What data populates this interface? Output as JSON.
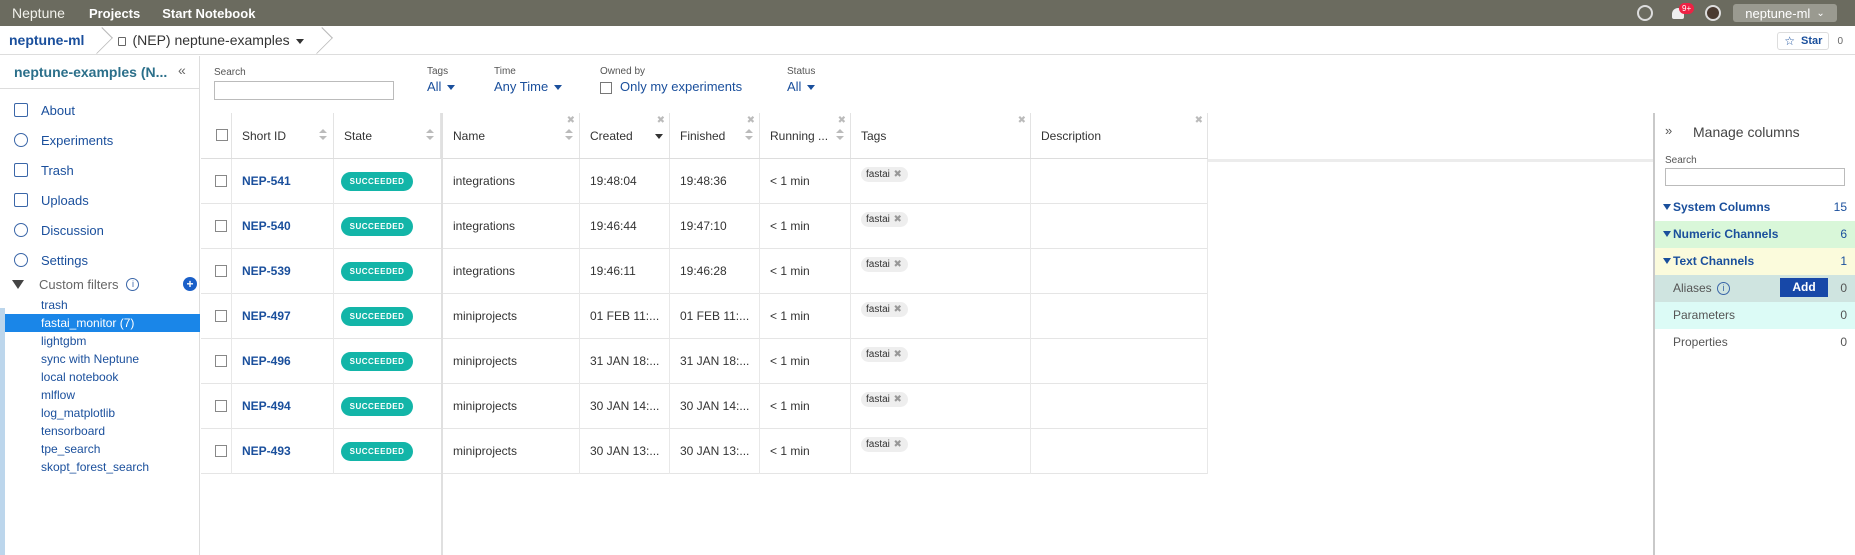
{
  "topbar": {
    "logo": "Neptune",
    "nav": [
      "Projects",
      "Start Notebook"
    ],
    "notification_badge": "9+",
    "user": "neptune-ml"
  },
  "breadcrumb": {
    "org": "neptune-ml",
    "project": "(NEP) neptune-examples",
    "star_label": "Star",
    "star_count": "0"
  },
  "sidebar": {
    "title": "neptune-examples (N...",
    "items": [
      {
        "label": "About",
        "icon": "document-icon"
      },
      {
        "label": "Experiments",
        "icon": "flask-icon"
      },
      {
        "label": "Trash",
        "icon": "trash-icon"
      },
      {
        "label": "Uploads",
        "icon": "database-icon"
      },
      {
        "label": "Discussion",
        "icon": "chat-icon"
      },
      {
        "label": "Settings",
        "icon": "gear-icon"
      }
    ],
    "custom_filters_label": "Custom filters",
    "filters": [
      "trash",
      "fastai_monitor (7)",
      "lightgbm",
      "sync with Neptune",
      "local notebook",
      "mlflow",
      "log_matplotlib",
      "tensorboard",
      "tpe_search",
      "skopt_forest_search"
    ]
  },
  "filters": {
    "search_label": "Search",
    "tags_label": "Tags",
    "tags_value": "All",
    "time_label": "Time",
    "time_value": "Any Time",
    "owned_label": "Owned by",
    "owned_value": "Only my experiments",
    "status_label": "Status",
    "status_value": "All"
  },
  "table": {
    "headers": [
      "Short ID",
      "State",
      "Name",
      "Created",
      "Finished",
      "Running ...",
      "Tags",
      "Description"
    ],
    "rows": [
      {
        "id": "NEP-541",
        "state": "SUCCEEDED",
        "name": "integrations",
        "created": "19:48:04",
        "finished": "19:48:36",
        "running": "< 1 min",
        "tag": "fastai"
      },
      {
        "id": "NEP-540",
        "state": "SUCCEEDED",
        "name": "integrations",
        "created": "19:46:44",
        "finished": "19:47:10",
        "running": "< 1 min",
        "tag": "fastai"
      },
      {
        "id": "NEP-539",
        "state": "SUCCEEDED",
        "name": "integrations",
        "created": "19:46:11",
        "finished": "19:46:28",
        "running": "< 1 min",
        "tag": "fastai"
      },
      {
        "id": "NEP-497",
        "state": "SUCCEEDED",
        "name": "miniprojects",
        "created": "01 FEB 11:...",
        "finished": "01 FEB 11:...",
        "running": "< 1 min",
        "tag": "fastai"
      },
      {
        "id": "NEP-496",
        "state": "SUCCEEDED",
        "name": "miniprojects",
        "created": "31 JAN 18:...",
        "finished": "31 JAN 18:...",
        "running": "< 1 min",
        "tag": "fastai"
      },
      {
        "id": "NEP-494",
        "state": "SUCCEEDED",
        "name": "miniprojects",
        "created": "30 JAN 14:...",
        "finished": "30 JAN 14:...",
        "running": "< 1 min",
        "tag": "fastai"
      },
      {
        "id": "NEP-493",
        "state": "SUCCEEDED",
        "name": "miniprojects",
        "created": "30 JAN 13:...",
        "finished": "30 JAN 13:...",
        "running": "< 1 min",
        "tag": "fastai"
      }
    ]
  },
  "columns_panel": {
    "title": "Manage columns",
    "search_label": "Search",
    "groups": [
      {
        "label": "System Columns",
        "count": "15",
        "color": "#ffffff"
      },
      {
        "label": "Numeric Channels",
        "count": "6",
        "color": "#d9f7d9"
      },
      {
        "label": "Text Channels",
        "count": "1",
        "color": "#fbfbdc"
      },
      {
        "label": "Aliases",
        "count": "0",
        "color": "#cfe4e0"
      },
      {
        "label": "Parameters",
        "count": "0",
        "color": "#dcfbf6"
      },
      {
        "label": "Properties",
        "count": "0",
        "color": "#ffffff"
      }
    ],
    "add_label": "Add"
  },
  "colors": {
    "accent": "#1a4f9c",
    "success": "#13b5a8",
    "selected_filter": "#1a86e8"
  }
}
